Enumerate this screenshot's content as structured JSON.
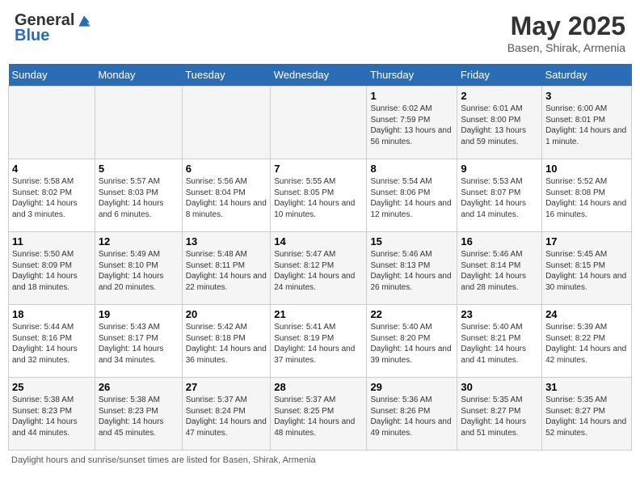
{
  "header": {
    "logo_general": "General",
    "logo_blue": "Blue",
    "title": "May 2025",
    "subtitle": "Basen, Shirak, Armenia"
  },
  "columns": [
    "Sunday",
    "Monday",
    "Tuesday",
    "Wednesday",
    "Thursday",
    "Friday",
    "Saturday"
  ],
  "weeks": [
    [
      {
        "day": "",
        "content": ""
      },
      {
        "day": "",
        "content": ""
      },
      {
        "day": "",
        "content": ""
      },
      {
        "day": "",
        "content": ""
      },
      {
        "day": "1",
        "content": "Sunrise: 6:02 AM\nSunset: 7:59 PM\nDaylight: 13 hours and 56 minutes."
      },
      {
        "day": "2",
        "content": "Sunrise: 6:01 AM\nSunset: 8:00 PM\nDaylight: 13 hours and 59 minutes."
      },
      {
        "day": "3",
        "content": "Sunrise: 6:00 AM\nSunset: 8:01 PM\nDaylight: 14 hours and 1 minute."
      }
    ],
    [
      {
        "day": "4",
        "content": "Sunrise: 5:58 AM\nSunset: 8:02 PM\nDaylight: 14 hours and 3 minutes."
      },
      {
        "day": "5",
        "content": "Sunrise: 5:57 AM\nSunset: 8:03 PM\nDaylight: 14 hours and 6 minutes."
      },
      {
        "day": "6",
        "content": "Sunrise: 5:56 AM\nSunset: 8:04 PM\nDaylight: 14 hours and 8 minutes."
      },
      {
        "day": "7",
        "content": "Sunrise: 5:55 AM\nSunset: 8:05 PM\nDaylight: 14 hours and 10 minutes."
      },
      {
        "day": "8",
        "content": "Sunrise: 5:54 AM\nSunset: 8:06 PM\nDaylight: 14 hours and 12 minutes."
      },
      {
        "day": "9",
        "content": "Sunrise: 5:53 AM\nSunset: 8:07 PM\nDaylight: 14 hours and 14 minutes."
      },
      {
        "day": "10",
        "content": "Sunrise: 5:52 AM\nSunset: 8:08 PM\nDaylight: 14 hours and 16 minutes."
      }
    ],
    [
      {
        "day": "11",
        "content": "Sunrise: 5:50 AM\nSunset: 8:09 PM\nDaylight: 14 hours and 18 minutes."
      },
      {
        "day": "12",
        "content": "Sunrise: 5:49 AM\nSunset: 8:10 PM\nDaylight: 14 hours and 20 minutes."
      },
      {
        "day": "13",
        "content": "Sunrise: 5:48 AM\nSunset: 8:11 PM\nDaylight: 14 hours and 22 minutes."
      },
      {
        "day": "14",
        "content": "Sunrise: 5:47 AM\nSunset: 8:12 PM\nDaylight: 14 hours and 24 minutes."
      },
      {
        "day": "15",
        "content": "Sunrise: 5:46 AM\nSunset: 8:13 PM\nDaylight: 14 hours and 26 minutes."
      },
      {
        "day": "16",
        "content": "Sunrise: 5:46 AM\nSunset: 8:14 PM\nDaylight: 14 hours and 28 minutes."
      },
      {
        "day": "17",
        "content": "Sunrise: 5:45 AM\nSunset: 8:15 PM\nDaylight: 14 hours and 30 minutes."
      }
    ],
    [
      {
        "day": "18",
        "content": "Sunrise: 5:44 AM\nSunset: 8:16 PM\nDaylight: 14 hours and 32 minutes."
      },
      {
        "day": "19",
        "content": "Sunrise: 5:43 AM\nSunset: 8:17 PM\nDaylight: 14 hours and 34 minutes."
      },
      {
        "day": "20",
        "content": "Sunrise: 5:42 AM\nSunset: 8:18 PM\nDaylight: 14 hours and 36 minutes."
      },
      {
        "day": "21",
        "content": "Sunrise: 5:41 AM\nSunset: 8:19 PM\nDaylight: 14 hours and 37 minutes."
      },
      {
        "day": "22",
        "content": "Sunrise: 5:40 AM\nSunset: 8:20 PM\nDaylight: 14 hours and 39 minutes."
      },
      {
        "day": "23",
        "content": "Sunrise: 5:40 AM\nSunset: 8:21 PM\nDaylight: 14 hours and 41 minutes."
      },
      {
        "day": "24",
        "content": "Sunrise: 5:39 AM\nSunset: 8:22 PM\nDaylight: 14 hours and 42 minutes."
      }
    ],
    [
      {
        "day": "25",
        "content": "Sunrise: 5:38 AM\nSunset: 8:23 PM\nDaylight: 14 hours and 44 minutes."
      },
      {
        "day": "26",
        "content": "Sunrise: 5:38 AM\nSunset: 8:23 PM\nDaylight: 14 hours and 45 minutes."
      },
      {
        "day": "27",
        "content": "Sunrise: 5:37 AM\nSunset: 8:24 PM\nDaylight: 14 hours and 47 minutes."
      },
      {
        "day": "28",
        "content": "Sunrise: 5:37 AM\nSunset: 8:25 PM\nDaylight: 14 hours and 48 minutes."
      },
      {
        "day": "29",
        "content": "Sunrise: 5:36 AM\nSunset: 8:26 PM\nDaylight: 14 hours and 49 minutes."
      },
      {
        "day": "30",
        "content": "Sunrise: 5:35 AM\nSunset: 8:27 PM\nDaylight: 14 hours and 51 minutes."
      },
      {
        "day": "31",
        "content": "Sunrise: 5:35 AM\nSunset: 8:27 PM\nDaylight: 14 hours and 52 minutes."
      }
    ]
  ],
  "footer": "Daylight hours and sunrise/sunset times are listed for Basen, Shirak, Armenia"
}
